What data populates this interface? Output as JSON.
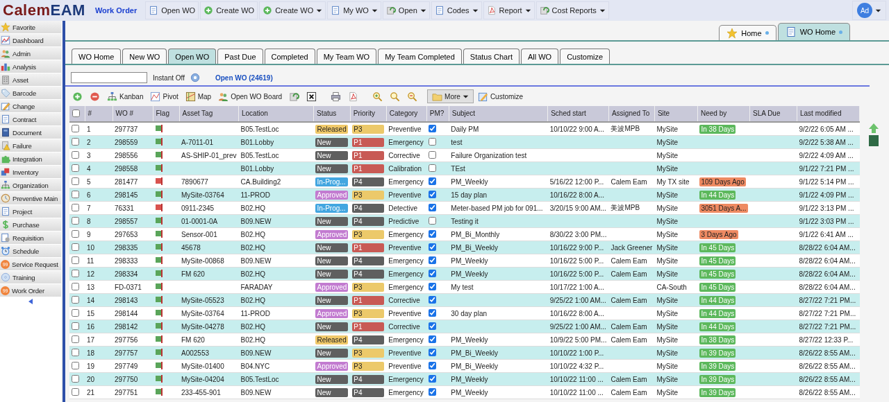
{
  "logo": {
    "part1": "Calem",
    "part2": "EAM"
  },
  "module": "Work Order",
  "menu": [
    {
      "label": "Open WO",
      "dropdown": false
    },
    {
      "label": "Create WO",
      "dropdown": false
    },
    {
      "label": "Create WO",
      "dropdown": true
    },
    {
      "label": "My WO",
      "dropdown": true
    },
    {
      "label": "Open",
      "dropdown": true
    },
    {
      "label": "Codes",
      "dropdown": true
    },
    {
      "label": "Report",
      "dropdown": true
    },
    {
      "label": "Cost Reports",
      "dropdown": true
    }
  ],
  "user": {
    "initials": "Ad"
  },
  "sidebar": {
    "items": [
      {
        "label": "Favorite"
      },
      {
        "label": "Dashboard"
      },
      {
        "label": "Admin"
      },
      {
        "label": "Analysis"
      },
      {
        "label": "Asset"
      },
      {
        "label": "Barcode"
      },
      {
        "label": "Change"
      },
      {
        "label": "Contract"
      },
      {
        "label": "Document"
      },
      {
        "label": "Failure"
      },
      {
        "label": "Integration"
      },
      {
        "label": "Inventory"
      },
      {
        "label": "Organization"
      },
      {
        "label": "Preventive Main"
      },
      {
        "label": "Project"
      },
      {
        "label": "Purchase"
      },
      {
        "label": "Requisition"
      },
      {
        "label": "Schedule"
      },
      {
        "label": "Service Request",
        "badge": "99"
      },
      {
        "label": "Training"
      },
      {
        "label": "Work Order",
        "badge": "99"
      }
    ]
  },
  "doc_tabs": [
    {
      "label": "Home",
      "selected": false
    },
    {
      "label": "WO Home",
      "selected": true
    }
  ],
  "tabs": [
    {
      "label": "WO Home",
      "selected": false
    },
    {
      "label": "New WO",
      "selected": false
    },
    {
      "label": "Open WO",
      "selected": true
    },
    {
      "label": "Past Due",
      "selected": false
    },
    {
      "label": "Completed",
      "selected": false
    },
    {
      "label": "My Team WO",
      "selected": false
    },
    {
      "label": "My Team Completed",
      "selected": false
    },
    {
      "label": "Status Chart",
      "selected": false
    },
    {
      "label": "All WO",
      "selected": false
    },
    {
      "label": "Customize",
      "selected": false
    }
  ],
  "search": {
    "instant": "Instant Off",
    "title": "Open WO (24619)"
  },
  "toolbar": [
    {
      "kind": "icon"
    },
    {
      "kind": "icon"
    },
    {
      "kind": "text",
      "label": "Kanban"
    },
    {
      "kind": "text",
      "label": "Pivot"
    },
    {
      "kind": "text",
      "label": "Map"
    },
    {
      "kind": "text",
      "label": "Open WO Board"
    },
    {
      "kind": "icon"
    },
    {
      "kind": "icon"
    },
    {
      "kind": "icon"
    },
    {
      "kind": "icon"
    },
    {
      "kind": "icon"
    },
    {
      "kind": "icon"
    },
    {
      "kind": "icon"
    },
    {
      "kind": "menu",
      "label": "More"
    },
    {
      "kind": "text",
      "label": "Customize"
    }
  ],
  "table": {
    "columns": [
      "#",
      "WO #",
      "Flag",
      "Asset Tag",
      "Location",
      "Status",
      "Priority",
      "Category",
      "PM?",
      "Subject",
      "Sched start",
      "Assigned To",
      "Site",
      "Need by",
      "SLA Due",
      "Last modified"
    ],
    "all_selected": false,
    "rows": [
      {
        "selected": false,
        "number": "1",
        "wo": "297737",
        "flag": {
          "color": "#5aa55a"
        },
        "location": "B05.TestLoc",
        "status": {
          "text": "Released",
          "color": "#f0c96a"
        },
        "priority": {
          "text": "P3",
          "color": "#ecc96a"
        },
        "category": "Preventive",
        "pm": true,
        "subject": "Daily PM",
        "sched_start": "10/10/22 9:00 A...",
        "assigned_to": "美波MPB",
        "site": "MySite",
        "need_by": {
          "text": "In 38 Days",
          "color": "#5cb85c"
        },
        "last_modified": "9/2/22 6:05 AM ..."
      },
      {
        "selected": false,
        "number": "2",
        "wo": "298559",
        "flag": {
          "color": "#5aa55a"
        },
        "asset_tag": "A-7011-01",
        "location": "B01.Lobby",
        "status": {
          "text": "New",
          "color": "#5f5f5f"
        },
        "priority": {
          "text": "P1",
          "color": "#c85a55"
        },
        "category": "Emergency",
        "pm": false,
        "subject": "test",
        "site": "MySite",
        "last_modified": "9/2/22 5:38 AM ..."
      },
      {
        "selected": false,
        "number": "3",
        "wo": "298556",
        "flag": {
          "color": "#5aa55a"
        },
        "asset_tag": "AS-SHIP-01_prev",
        "location": "B05.TestLoc",
        "status": {
          "text": "New",
          "color": "#5f5f5f"
        },
        "priority": {
          "text": "P1",
          "color": "#c85a55"
        },
        "category": "Corrective",
        "pm": false,
        "subject": "Failure Organization test",
        "site": "MySite",
        "last_modified": "9/2/22 4:09 AM ..."
      },
      {
        "selected": false,
        "number": "4",
        "wo": "298558",
        "flag": {
          "color": "#5aa55a"
        },
        "location": "B01.Lobby",
        "status": {
          "text": "New",
          "color": "#5f5f5f"
        },
        "priority": {
          "text": "P1",
          "color": "#c85a55"
        },
        "category": "Calibration",
        "pm": false,
        "subject": "TEst",
        "site": "MySite",
        "last_modified": "9/1/22 7:21 PM ..."
      },
      {
        "selected": false,
        "number": "5",
        "wo": "281477",
        "flag": {
          "color": "#d9534f"
        },
        "asset_tag": "7890677",
        "location": "CA.Building2",
        "status": {
          "text": "In-Prog...",
          "color": "#43a6e0"
        },
        "priority": {
          "text": "P4",
          "color": "#5f5f5f"
        },
        "category": "Emergency",
        "pm": true,
        "subject": "PM_Weekly",
        "sched_start": "5/16/22 12:00 P...",
        "assigned_to": "Calem Eam",
        "site": "My TX site",
        "need_by": {
          "text": "109 Days Ago",
          "color": "#ee8a62"
        },
        "last_modified": "9/1/22 5:14 PM ..."
      },
      {
        "selected": false,
        "number": "6",
        "wo": "298145",
        "flag": {
          "color": "#5aa55a"
        },
        "asset_tag": "MySite-03764",
        "location": "11-PROD",
        "status": {
          "text": "Approved",
          "color": "#c27bd0"
        },
        "priority": {
          "text": "P3",
          "color": "#ecc96a"
        },
        "category": "Preventive",
        "pm": true,
        "subject": "15 day plan",
        "sched_start": "10/16/22 8:00 A...",
        "site": "MySite",
        "need_by": {
          "text": "In 44 Days",
          "color": "#5cb85c"
        },
        "last_modified": "9/1/22 4:09 PM ..."
      },
      {
        "selected": false,
        "number": "7",
        "wo": "76331",
        "flag": {
          "color": "#d9534f"
        },
        "asset_tag": "0911-2345",
        "location": "B02.HQ",
        "status": {
          "text": "In-Prog...",
          "color": "#43a6e0"
        },
        "priority": {
          "text": "P4",
          "color": "#5f5f5f"
        },
        "category": "Detective",
        "pm": true,
        "subject": "Meter-based PM job for 091...",
        "sched_start": "3/20/15 9:00 AM...",
        "assigned_to": "美波MPB",
        "site": "MySite",
        "need_by": {
          "text": "3051 Days A...",
          "color": "#ee8a62"
        },
        "last_modified": "9/1/22 3:13 PM ..."
      },
      {
        "selected": false,
        "number": "8",
        "wo": "298557",
        "flag": {
          "color": "#5aa55a"
        },
        "asset_tag": "01-0001-0A",
        "location": "B09.NEW",
        "status": {
          "text": "New",
          "color": "#5f5f5f"
        },
        "priority": {
          "text": "P4",
          "color": "#5f5f5f"
        },
        "category": "Predictive",
        "pm": false,
        "subject": "Testing it",
        "site": "MySite",
        "last_modified": "9/1/22 3:03 PM ..."
      },
      {
        "selected": false,
        "number": "9",
        "wo": "297653",
        "flag": {
          "color": "#5aa55a"
        },
        "asset_tag": "Sensor-001",
        "location": "B02.HQ",
        "status": {
          "text": "Approved",
          "color": "#c27bd0"
        },
        "priority": {
          "text": "P3",
          "color": "#ecc96a"
        },
        "category": "Emergency",
        "pm": true,
        "subject": "PM_Bi_Monthly",
        "sched_start": "8/30/22 3:00 PM...",
        "site": "MySite",
        "need_by": {
          "text": "3 Days Ago",
          "color": "#ee8a62"
        },
        "last_modified": "9/1/22 6:41 AM ..."
      },
      {
        "selected": false,
        "number": "10",
        "wo": "298335",
        "flag": {
          "color": "#5aa55a"
        },
        "asset_tag": "45678",
        "location": "B02.HQ",
        "status": {
          "text": "New",
          "color": "#5f5f5f"
        },
        "priority": {
          "text": "P1",
          "color": "#c85a55"
        },
        "category": "Preventive",
        "pm": true,
        "subject": "PM_Bi_Weekly",
        "sched_start": "10/16/22 9:00 P...",
        "assigned_to": "Jack Greener",
        "site": "MySite",
        "need_by": {
          "text": "In 45 Days",
          "color": "#5cb85c"
        },
        "last_modified": "8/28/22 6:04 AM..."
      },
      {
        "selected": false,
        "number": "11",
        "wo": "298333",
        "flag": {
          "color": "#5aa55a"
        },
        "asset_tag": "MySite-00868",
        "location": "B09.NEW",
        "status": {
          "text": "New",
          "color": "#5f5f5f"
        },
        "priority": {
          "text": "P4",
          "color": "#5f5f5f"
        },
        "category": "Emergency",
        "pm": true,
        "subject": "PM_Weekly",
        "sched_start": "10/16/22 5:00 P...",
        "assigned_to": "Calem Eam",
        "site": "MySite",
        "need_by": {
          "text": "In 45 Days",
          "color": "#5cb85c"
        },
        "last_modified": "8/28/22 6:04 AM..."
      },
      {
        "selected": false,
        "number": "12",
        "wo": "298334",
        "flag": {
          "color": "#5aa55a"
        },
        "asset_tag": "FM 620",
        "location": "B02.HQ",
        "status": {
          "text": "New",
          "color": "#5f5f5f"
        },
        "priority": {
          "text": "P4",
          "color": "#5f5f5f"
        },
        "category": "Emergency",
        "pm": true,
        "subject": "PM_Weekly",
        "sched_start": "10/16/22 5:00 P...",
        "assigned_to": "Calem Eam",
        "site": "MySite",
        "need_by": {
          "text": "In 45 Days",
          "color": "#5cb85c"
        },
        "last_modified": "8/28/22 6:04 AM..."
      },
      {
        "selected": false,
        "number": "13",
        "wo": "FD-0371",
        "flag": {
          "color": "#5aa55a"
        },
        "location": "FARADAY",
        "status": {
          "text": "Approved",
          "color": "#c27bd0"
        },
        "priority": {
          "text": "P3",
          "color": "#ecc96a"
        },
        "category": "Emergency",
        "pm": true,
        "subject": "My test",
        "sched_start": "10/17/22 1:00 A...",
        "site": "CA-South",
        "need_by": {
          "text": "In 45 Days",
          "color": "#5cb85c"
        },
        "last_modified": "8/28/22 6:04 AM..."
      },
      {
        "selected": false,
        "number": "14",
        "wo": "298143",
        "flag": {
          "color": "#5aa55a"
        },
        "asset_tag": "MySite-05523",
        "location": "B02.HQ",
        "status": {
          "text": "New",
          "color": "#5f5f5f"
        },
        "priority": {
          "text": "P1",
          "color": "#c85a55"
        },
        "category": "Corrective",
        "pm": true,
        "sched_start": "9/25/22 1:00 AM...",
        "assigned_to": "Calem Eam",
        "site": "MySite",
        "need_by": {
          "text": "In 44 Days",
          "color": "#5cb85c"
        },
        "last_modified": "8/27/22 7:21 PM..."
      },
      {
        "selected": false,
        "number": "15",
        "wo": "298144",
        "flag": {
          "color": "#5aa55a"
        },
        "asset_tag": "MySite-03764",
        "location": "11-PROD",
        "status": {
          "text": "Approved",
          "color": "#c27bd0"
        },
        "priority": {
          "text": "P3",
          "color": "#ecc96a"
        },
        "category": "Preventive",
        "pm": true,
        "subject": "30 day plan",
        "sched_start": "10/16/22 8:00 A...",
        "site": "MySite",
        "need_by": {
          "text": "In 44 Days",
          "color": "#5cb85c"
        },
        "last_modified": "8/27/22 7:21 PM..."
      },
      {
        "selected": false,
        "number": "16",
        "wo": "298142",
        "flag": {
          "color": "#5aa55a"
        },
        "asset_tag": "MySite-04278",
        "location": "B02.HQ",
        "status": {
          "text": "New",
          "color": "#5f5f5f"
        },
        "priority": {
          "text": "P1",
          "color": "#c85a55"
        },
        "category": "Corrective",
        "pm": true,
        "sched_start": "9/25/22 1:00 AM...",
        "assigned_to": "Calem Eam",
        "site": "MySite",
        "need_by": {
          "text": "In 44 Days",
          "color": "#5cb85c"
        },
        "last_modified": "8/27/22 7:21 PM..."
      },
      {
        "selected": false,
        "number": "17",
        "wo": "297756",
        "flag": {
          "color": "#5aa55a"
        },
        "asset_tag": "FM 620",
        "location": "B02.HQ",
        "status": {
          "text": "Released",
          "color": "#f0c96a"
        },
        "priority": {
          "text": "P4",
          "color": "#5f5f5f"
        },
        "category": "Emergency",
        "pm": true,
        "subject": "PM_Weekly",
        "sched_start": "10/9/22 5:00 PM...",
        "assigned_to": "Calem Eam",
        "site": "MySite",
        "need_by": {
          "text": "In 38 Days",
          "color": "#5cb85c"
        },
        "last_modified": "8/27/22 12:33 P..."
      },
      {
        "selected": false,
        "number": "18",
        "wo": "297757",
        "flag": {
          "color": "#5aa55a"
        },
        "asset_tag": "A002553",
        "location": "B09.NEW",
        "status": {
          "text": "New",
          "color": "#5f5f5f"
        },
        "priority": {
          "text": "P3",
          "color": "#ecc96a"
        },
        "category": "Preventive",
        "pm": true,
        "subject": "PM_Bi_Weekly",
        "sched_start": "10/10/22 1:00 P...",
        "site": "MySite",
        "need_by": {
          "text": "In 39 Days",
          "color": "#5cb85c"
        },
        "last_modified": "8/26/22 8:55 AM..."
      },
      {
        "selected": false,
        "number": "19",
        "wo": "297749",
        "flag": {
          "color": "#5aa55a"
        },
        "asset_tag": "MySite-01400",
        "location": "B04.NYC",
        "status": {
          "text": "Approved",
          "color": "#c27bd0"
        },
        "priority": {
          "text": "P3",
          "color": "#ecc96a"
        },
        "category": "Preventive",
        "pm": true,
        "subject": "PM_Bi_Weekly",
        "sched_start": "10/10/22 4:32 P...",
        "site": "MySite",
        "need_by": {
          "text": "In 39 Days",
          "color": "#5cb85c"
        },
        "last_modified": "8/26/22 8:55 AM..."
      },
      {
        "selected": false,
        "number": "20",
        "wo": "297750",
        "flag": {
          "color": "#5aa55a"
        },
        "asset_tag": "MySite-04204",
        "location": "B05.TestLoc",
        "status": {
          "text": "New",
          "color": "#5f5f5f"
        },
        "priority": {
          "text": "P4",
          "color": "#5f5f5f"
        },
        "category": "Emergency",
        "pm": true,
        "subject": "PM_Weekly",
        "sched_start": "10/10/22 11:00 ...",
        "assigned_to": "Calem Eam",
        "site": "MySite",
        "need_by": {
          "text": "In 39 Days",
          "color": "#5cb85c"
        },
        "last_modified": "8/26/22 8:55 AM..."
      },
      {
        "selected": false,
        "number": "21",
        "wo": "297751",
        "flag": {
          "color": "#5aa55a"
        },
        "asset_tag": "233-455-901",
        "location": "B09.NEW",
        "status": {
          "text": "New",
          "color": "#5f5f5f"
        },
        "priority": {
          "text": "P4",
          "color": "#5f5f5f"
        },
        "category": "Emergency",
        "pm": true,
        "subject": "PM_Weekly",
        "sched_start": "10/10/22 11:00 ...",
        "assigned_to": "Calem Eam",
        "site": "MySite",
        "need_by": {
          "text": "In 39 Days",
          "color": "#5cb85c"
        },
        "last_modified": "8/26/22 8:55 AM..."
      }
    ]
  }
}
